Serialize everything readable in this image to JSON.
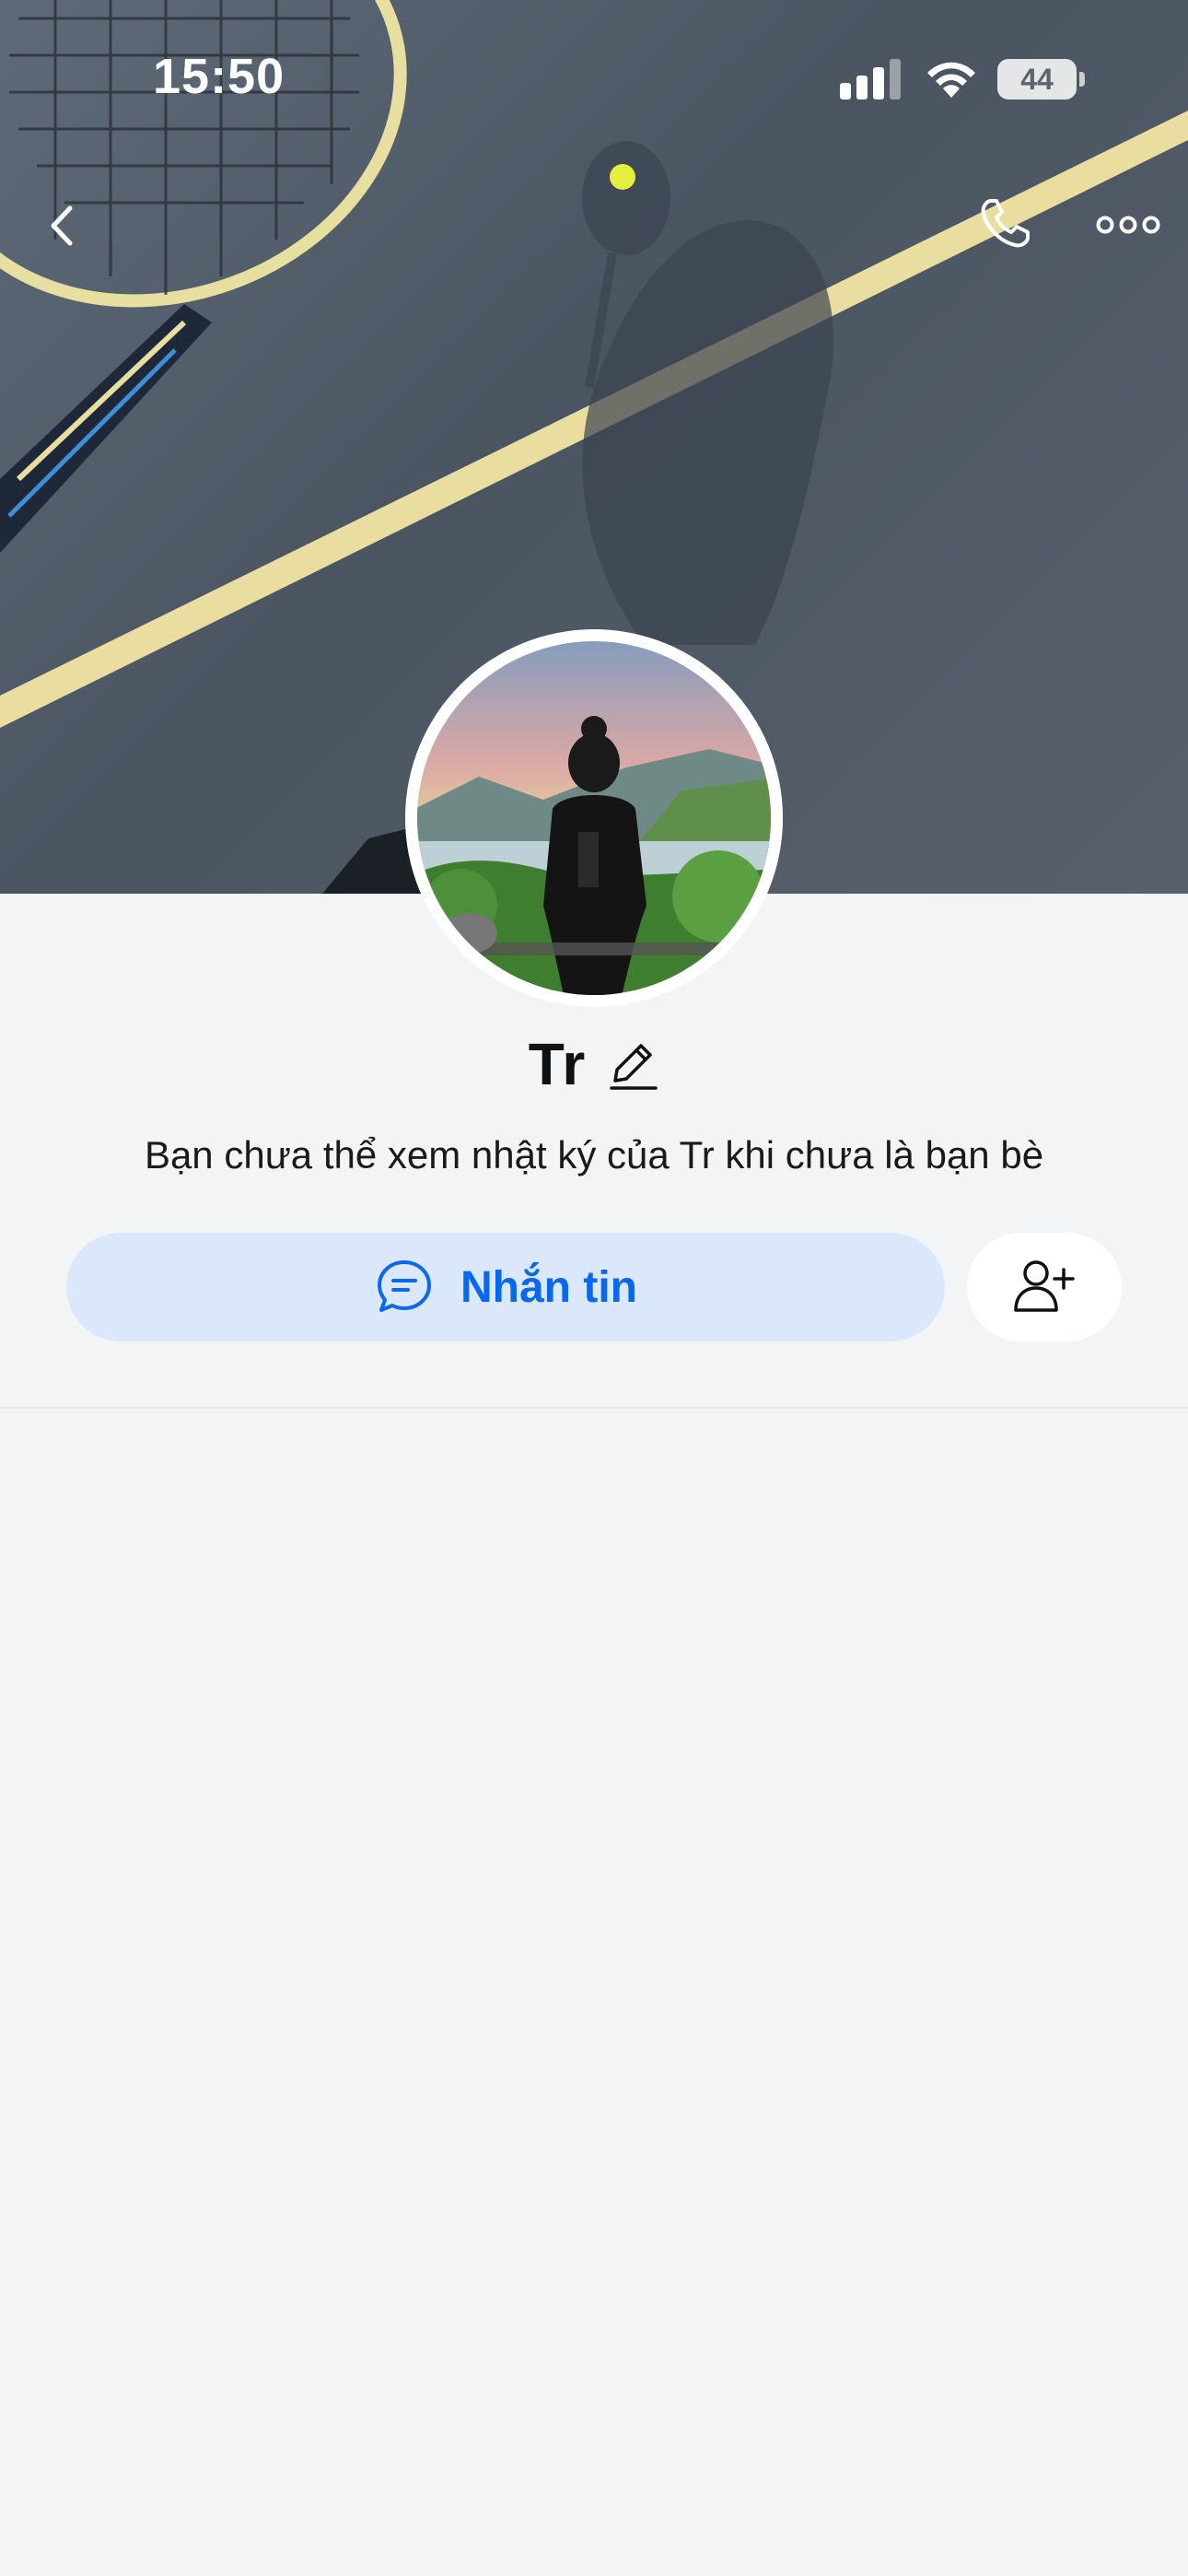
{
  "status_bar": {
    "time": "15:50",
    "battery": "44"
  },
  "profile": {
    "name": "Tr",
    "notice": "Bạn chưa thể xem nhật ký của Tr khi chưa là bạn bè"
  },
  "actions": {
    "message_label": "Nhắn tin"
  },
  "colors": {
    "accent": "#0a68f0",
    "button_bg": "#dbe8fc",
    "page_bg": "#f3f4f6"
  },
  "icons": [
    "chevron-left-icon",
    "phone-icon",
    "more-icon",
    "edit-pencil-icon",
    "chat-bubble-icon",
    "add-friend-icon"
  ]
}
